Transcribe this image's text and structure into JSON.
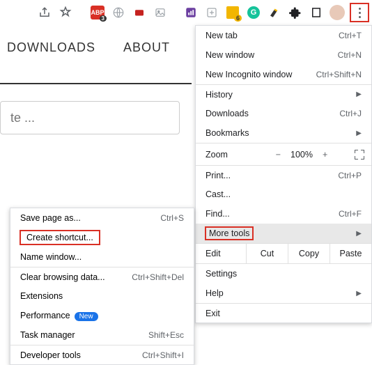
{
  "toolbar_badges": {
    "abp": "ABP",
    "abp_count": "3",
    "gm_count": "6"
  },
  "nav": {
    "downloads": "DOWNLOADS",
    "about": "ABOUT"
  },
  "search_placeholder": "te ...",
  "menu": {
    "new_tab": "New tab",
    "new_tab_sc": "Ctrl+T",
    "new_window": "New window",
    "new_window_sc": "Ctrl+N",
    "incognito": "New Incognito window",
    "incognito_sc": "Ctrl+Shift+N",
    "history": "History",
    "downloads": "Downloads",
    "downloads_sc": "Ctrl+J",
    "bookmarks": "Bookmarks",
    "zoom": "Zoom",
    "zoom_minus": "−",
    "zoom_val": "100%",
    "zoom_plus": "+",
    "print": "Print...",
    "print_sc": "Ctrl+P",
    "cast": "Cast...",
    "find": "Find...",
    "find_sc": "Ctrl+F",
    "more_tools": "More tools",
    "edit": "Edit",
    "cut": "Cut",
    "copy": "Copy",
    "paste": "Paste",
    "settings": "Settings",
    "help": "Help",
    "exit": "Exit"
  },
  "submenu": {
    "save_page": "Save page as...",
    "save_page_sc": "Ctrl+S",
    "create_shortcut": "Create shortcut...",
    "name_window": "Name window...",
    "clear_data": "Clear browsing data...",
    "clear_data_sc": "Ctrl+Shift+Del",
    "extensions": "Extensions",
    "performance": "Performance",
    "perf_badge": "New",
    "task_manager": "Task manager",
    "task_manager_sc": "Shift+Esc",
    "dev_tools": "Developer tools",
    "dev_tools_sc": "Ctrl+Shift+I"
  }
}
